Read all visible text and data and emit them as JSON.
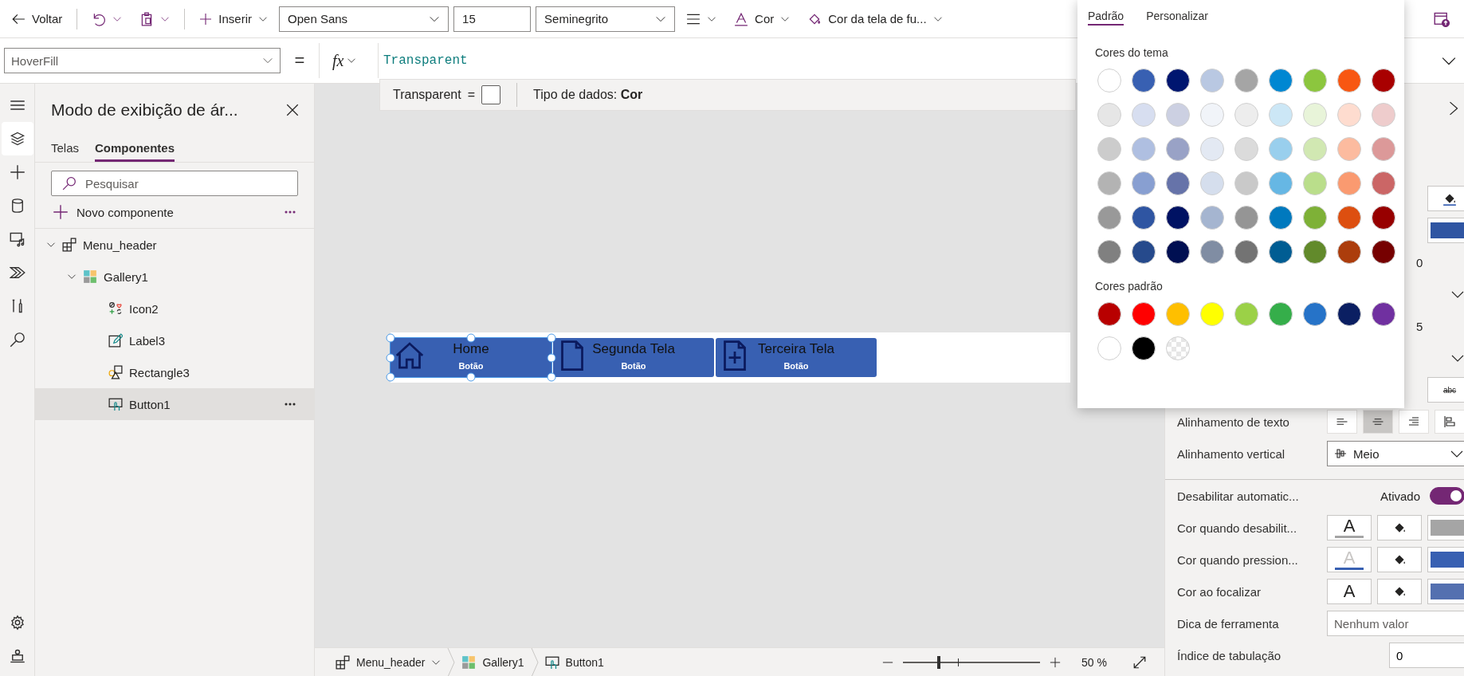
{
  "toolbar": [
    {
      "kind": "back",
      "label": "Voltar"
    },
    {
      "kind": "separator"
    },
    {
      "kind": "undo"
    },
    {
      "kind": "paste"
    },
    {
      "kind": "separator"
    },
    {
      "kind": "insert",
      "label": "Inserir"
    },
    {
      "kind": "select",
      "value": "Open Sans"
    },
    {
      "kind": "input",
      "value": "15"
    },
    {
      "kind": "select",
      "value": "Seminegrito"
    },
    {
      "kind": "align"
    },
    {
      "kind": "text_color",
      "label": "Cor"
    },
    {
      "kind": "fill",
      "label": "Cor da tela de fu..."
    },
    {
      "kind": "publish"
    }
  ],
  "formula_bar": {
    "property": "HoverFill",
    "equals": "=",
    "fx": "fx",
    "formula": "Transparent"
  },
  "formula_hint": {
    "value": "Transparent",
    "equals": "=",
    "type_text": "Tipo de dados: **Cor**"
  },
  "left_rail": [
    {
      "kind": "menu",
      "selected": false
    },
    {
      "kind": "layers",
      "selected": true
    },
    {
      "kind": "insert",
      "selected": false
    },
    {
      "kind": "data",
      "selected": false
    },
    {
      "kind": "media",
      "selected": false
    },
    {
      "kind": "automate",
      "selected": false
    },
    {
      "kind": "tools",
      "selected": false
    },
    {
      "kind": "search",
      "selected": false
    },
    {
      "kind": "settings",
      "selected": false
    },
    {
      "kind": "agent",
      "selected": false
    }
  ],
  "tree_panel": {
    "title": "Modo de exibição de ár...",
    "tabs": [
      {
        "label": "Telas",
        "selected": false
      },
      {
        "label": "Componentes",
        "selected": true
      }
    ],
    "search": {
      "placeholder": "Pesquisar"
    },
    "new_component": "Novo componente",
    "tree": [
      {
        "label": "Menu_header",
        "kind": "component",
        "expanded": true,
        "selected": false,
        "children": [
          {
            "label": "Gallery1",
            "kind": "gallery",
            "expanded": true,
            "selected": false,
            "children": [
              {
                "label": "Icon2",
                "kind": "icon",
                "selected": false
              },
              {
                "label": "Label3",
                "kind": "label",
                "selected": false
              },
              {
                "label": "Rectangle3",
                "kind": "rectangle",
                "selected": false
              },
              {
                "label": "Button1",
                "kind": "button",
                "selected": true
              }
            ]
          }
        ]
      }
    ]
  },
  "canvas": {
    "gallery": [
      {
        "kind": "home",
        "label": "Home",
        "button_text": "Botão",
        "selected": true
      },
      {
        "kind": "document",
        "label": "Segunda Tela",
        "button_text": "Botão",
        "selected": false
      },
      {
        "kind": "document_plus",
        "label": "Terceira Tela",
        "button_text": "Botão",
        "selected": false
      }
    ]
  },
  "status_bar": {
    "breadcrumbs": [
      {
        "kind": "component",
        "label": "Menu_header"
      },
      {
        "kind": "gallery",
        "label": "Gallery1"
      },
      {
        "kind": "button",
        "label": "Button1"
      }
    ],
    "zoom": {
      "level": 0.26,
      "reading": "50 %"
    }
  },
  "color_picker": {
    "tabs": [
      {
        "label": "Padrão",
        "selected": true
      },
      {
        "label": "Personalizar",
        "selected": false
      }
    ],
    "sections": [
      {
        "title": "Cores do tema",
        "swatches": [
          {
            "color": "#ffffff"
          },
          {
            "color": "#3860b2"
          },
          {
            "color": "#001670"
          },
          {
            "color": "#b9c8e2"
          },
          {
            "color": "#a5a5a5"
          },
          {
            "color": "#0087d2"
          },
          {
            "color": "#8cc63e"
          },
          {
            "color": "#f85712"
          },
          {
            "color": "#a80000"
          },
          {
            "color": "#e6e6e6"
          },
          {
            "color": "#d7def0"
          },
          {
            "color": "#ccd0e2"
          },
          {
            "color": "#f1f4f9"
          },
          {
            "color": "#ededed"
          },
          {
            "color": "#cce7f6"
          },
          {
            "color": "#e8f4d9"
          },
          {
            "color": "#fedccf"
          },
          {
            "color": "#eecccc"
          },
          {
            "color": "#cccccc"
          },
          {
            "color": "#afbfe1"
          },
          {
            "color": "#99a2c6"
          },
          {
            "color": "#e3e9f3"
          },
          {
            "color": "#dbdbdb"
          },
          {
            "color": "#99cfed"
          },
          {
            "color": "#d1e8b2"
          },
          {
            "color": "#fcbb9f"
          },
          {
            "color": "#dc9999"
          },
          {
            "color": "#b3b3b3"
          },
          {
            "color": "#889fd1"
          },
          {
            "color": "#6673a9"
          },
          {
            "color": "#d5deed"
          },
          {
            "color": "#c9c9c9"
          },
          {
            "color": "#66b7e4"
          },
          {
            "color": "#bade8b"
          },
          {
            "color": "#fa9a70"
          },
          {
            "color": "#cb6666"
          },
          {
            "color": "#999999"
          },
          {
            "color": "#2f55a2"
          },
          {
            "color": "#001263"
          },
          {
            "color": "#a5b5d0"
          },
          {
            "color": "#959595"
          },
          {
            "color": "#0079be"
          },
          {
            "color": "#7eb137"
          },
          {
            "color": "#dd4f10"
          },
          {
            "color": "#970000"
          },
          {
            "color": "#808080"
          },
          {
            "color": "#264a8c"
          },
          {
            "color": "#000f52"
          },
          {
            "color": "#808da3"
          },
          {
            "color": "#737373"
          },
          {
            "color": "#005d93"
          },
          {
            "color": "#628a2b"
          },
          {
            "color": "#ac3d0c"
          },
          {
            "color": "#760000"
          }
        ]
      },
      {
        "title": "Cores padrão",
        "swatches": [
          {
            "color": "#b80000"
          },
          {
            "color": "#ff0000"
          },
          {
            "color": "#ffbf00"
          },
          {
            "color": "#ffff00"
          },
          {
            "color": "#9bd147"
          },
          {
            "color": "#35ae4a"
          },
          {
            "color": "#2673c8"
          },
          {
            "color": "#0b1f62"
          },
          {
            "color": "#7030a0"
          },
          {
            "color": "#ffffff"
          },
          {
            "color": "#000000"
          },
          {
            "kind": "transparent"
          }
        ]
      }
    ]
  },
  "properties": {
    "partial_rows": [
      {
        "kind": "fill_button",
        "color": "#3860b2"
      },
      {
        "kind": "swatch",
        "color": "#2f55a2"
      },
      {
        "kind": "value",
        "text": "0"
      },
      {
        "kind": "chevron"
      },
      {
        "kind": "value",
        "text": "5"
      },
      {
        "kind": "chevron"
      },
      {
        "kind": "strike_button",
        "text": "abc"
      }
    ],
    "rows": [
      {
        "kind": "text_align",
        "label": "Alinhamento de texto",
        "options": [
          {
            "kind": "left",
            "selected": false
          },
          {
            "kind": "center",
            "selected": true
          },
          {
            "kind": "right",
            "selected": false
          },
          {
            "kind": "top",
            "selected": false
          }
        ]
      },
      {
        "kind": "dropdown",
        "label": "Alinhamento vertical",
        "value": "Meio"
      },
      {
        "kind": "toggle",
        "label": "Desabilitar automatic...",
        "state_text": "Ativado",
        "on": true
      },
      {
        "kind": "colors",
        "label": "Cor quando desabilit...",
        "glyph": "A",
        "dim": false,
        "underlined": true,
        "color": "#a5a5a5"
      },
      {
        "kind": "colors",
        "label": "Cor quando pression...",
        "glyph": "A",
        "dim": true,
        "underlined": true,
        "color": "#3860b2"
      },
      {
        "kind": "colors",
        "label": "Cor ao focalizar",
        "glyph": "A",
        "dim": false,
        "underlined": false,
        "color": "#5470b0"
      },
      {
        "kind": "field",
        "label": "Dica de ferramenta",
        "placeholder": "Nenhum valor"
      },
      {
        "kind": "number",
        "label": "Índice de tabulação",
        "value": "0"
      }
    ]
  }
}
